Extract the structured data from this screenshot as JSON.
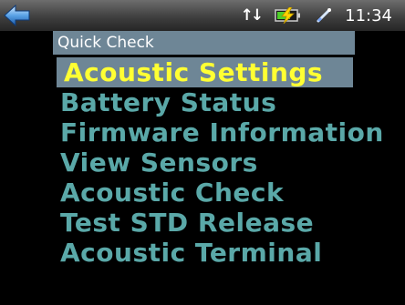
{
  "status": {
    "time": "11:34",
    "icons": [
      "back-arrow-icon",
      "sync-arrows-icon",
      "battery-charging-icon",
      "pen-icon"
    ],
    "sync_glyph": "↑↓"
  },
  "panel": {
    "title": "Quick Check",
    "selected_index": 0,
    "items": [
      "Acoustic Settings",
      "Battery Status",
      "Firmware Information",
      "View Sensors",
      "Acoustic Check",
      "Test STD Release",
      "Acoustic Terminal"
    ]
  },
  "colors": {
    "panel_header": "#6e8696",
    "menu_text": "#5aa8a8",
    "selected_text": "#ffff33",
    "background": "#000000"
  }
}
